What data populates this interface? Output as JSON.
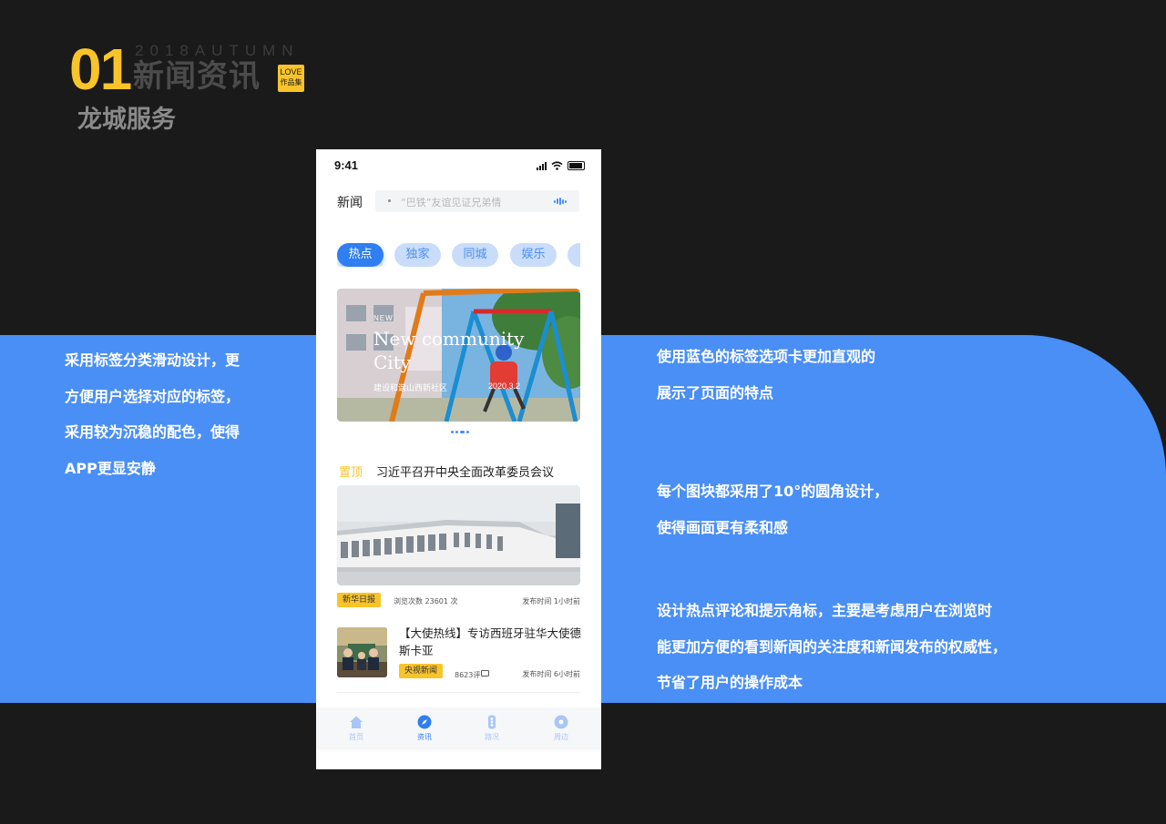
{
  "header": {
    "number": "01",
    "autumn": "2018AUTUMN",
    "title": "新闻资讯",
    "badge_line1": "LOVE",
    "badge_line2": "作品集",
    "subtitle": "龙城服务"
  },
  "left_description": [
    "采用标签分类滑动设计，更",
    "方便用户选择对应的标签，",
    "采用较为沉稳的配色，使得",
    "APP更显安静"
  ],
  "right_description": {
    "block1": [
      "使用蓝色的标签选项卡更加直观的",
      "展示了页面的特点"
    ],
    "block2": [
      "每个图块都采用了10°的圆角设计，",
      "使得画面更有柔和感"
    ],
    "block3": [
      "设计热点评论和提示角标，主要是考虑用户在浏览时",
      "能更加方便的看到新闻的关注度和新闻发布的权威性，",
      "节省了用户的操作成本"
    ]
  },
  "phone": {
    "status_time": "9:41",
    "nav_title": "新闻",
    "search_placeholder": "“巴铁”友谊见证兄弟情",
    "tabs": [
      "热点",
      "独家",
      "同城",
      "娱乐"
    ],
    "banner": {
      "tag": "NEW",
      "title": "New community City",
      "subtitle": "建设和谐山西新社区",
      "date": "2020.3.2"
    },
    "pinned": {
      "label": "置顶",
      "title": "习近平召开中央全面改革委员会议",
      "source": "新华日报",
      "views": "浏览次数 23601 次",
      "time": "发布时间 1小时前"
    },
    "news2": {
      "title": "【大使热线】专访西班牙驻华大使德斯卡亚",
      "source": "央视新闻",
      "comments": "8623评",
      "time": "发布时间 6小时前"
    },
    "tabbar": [
      "首页",
      "资讯",
      "路况",
      "周边"
    ]
  },
  "colors": {
    "accent_blue": "#4a8ff5",
    "tab_active": "#2f7ef2",
    "accent_yellow": "#f8c42a",
    "background": "#1a1a1a"
  }
}
